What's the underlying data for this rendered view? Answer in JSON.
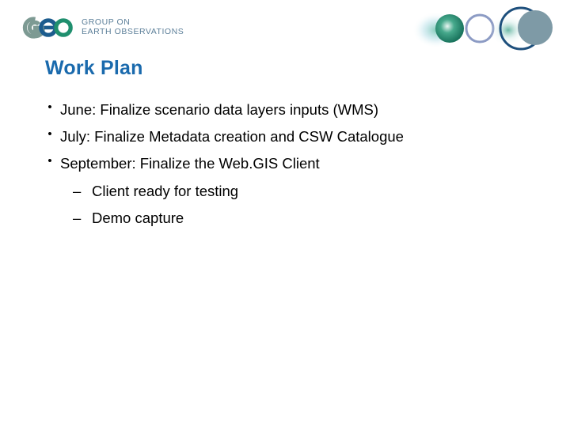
{
  "slide": {
    "title": "Work Plan",
    "title_color": "#1a6aad",
    "background_color": "#ffffff"
  },
  "logo": {
    "mark_name": "geo-logo-mark",
    "mark_letters": "GEO",
    "line1": "GROUP ON",
    "line2": "EARTH OBSERVATIONS",
    "text_color": "#5c7f99",
    "colors": {
      "g_letter": "#7d9a93",
      "e_letter": "#1c5c8e",
      "o_letter": "#1f8f6e"
    }
  },
  "decor": {
    "name": "decorative-spheres",
    "colors": {
      "green_sphere": "#1f8a70",
      "light_ring": "#8c9bc4",
      "navy_ring": "#1d4f7c",
      "gray_circle": "#7e9aa6"
    }
  },
  "content": {
    "bullet_marker": "•",
    "sub_marker": "–",
    "items": [
      {
        "level": 1,
        "text": "June: Finalize scenario data layers inputs (WMS)"
      },
      {
        "level": 1,
        "text": "July: Finalize Metadata creation and CSW Catalogue"
      },
      {
        "level": 1,
        "text": "September: Finalize the Web.GIS Client"
      },
      {
        "level": 2,
        "text": "Client ready for testing"
      },
      {
        "level": 2,
        "text": "Demo capture"
      }
    ]
  }
}
